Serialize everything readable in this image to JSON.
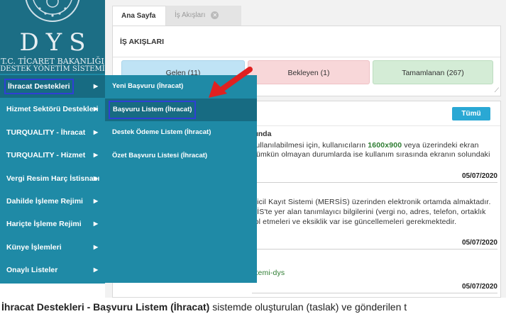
{
  "logo": {
    "title": "DYS",
    "line1": "T.C. TİCARET BAKANLIĞI",
    "line2": "DESTEK YÖNETİM SİSTEMİ"
  },
  "sidebar": {
    "items": [
      {
        "label": "İhracat Destekleri"
      },
      {
        "label": "Hizmet Sektörü Destekleri"
      },
      {
        "label": "TURQUALITY - İhracat"
      },
      {
        "label": "TURQUALITY - Hizmet"
      },
      {
        "label": "Vergi Resim Harç İstisnası"
      },
      {
        "label": "Dahilde İşleme Rejimi"
      },
      {
        "label": "Hariçte İşleme Rejimi"
      },
      {
        "label": "Künye İşlemleri"
      },
      {
        "label": "Onaylı Listeler"
      }
    ],
    "arrow_glyph": "▶"
  },
  "submenu": {
    "items": [
      {
        "label": "Yeni Başvuru (İhracat)"
      },
      {
        "label": "Başvuru Listem (İhracat)"
      },
      {
        "label": "Destek Ödeme Listem (İhracat)"
      },
      {
        "label": "Özet Başvuru Listesi (İhracat)"
      }
    ]
  },
  "tabs": {
    "home": "Ana Sayfa",
    "work": "İş Akışları",
    "close_glyph": "✕"
  },
  "workflow": {
    "title": "İŞ AKIŞLARI",
    "incoming": "Gelen (11)",
    "pending": "Bekleyen (1)",
    "completed": "Tamamlanan (267)"
  },
  "news": {
    "all_button": "Tümü",
    "item1": {
      "title": "kında",
      "line1_pre": "kullanılabilmesi için, kullanıcıların ",
      "line1_hl": "1600x900",
      "line1_post": " veya üzerindeki ekran",
      "line2": "nümkün olmayan durumlarda ise kullanım sırasında ekranın solundaki",
      "date": "05/07/2020"
    },
    "item2": {
      "line1": "Sicil Kayıt Sistemi (MERSİS) üzerinden elektronik ortamda almaktadır.",
      "line2": "SİS'te yer alan tanımlayıcı bilgilerini (vergi no, adres, telefon, ortaklık",
      "line3": "rol etmeleri ve eksiklik var ise güncellemeleri gerekmektedir.",
      "date": "05/07/2020"
    },
    "item3": {
      "line1": "stemi-dys",
      "date": "05/07/2020"
    }
  },
  "caption": {
    "bold": "İhracat Destekleri - Başvuru Listem (İhracat)",
    "rest": " sistemde oluşturulan (taslak) ve gönderilen t"
  },
  "colors": {
    "sidebar": "#1f8aa6",
    "sidebar_active": "#176b82",
    "highlight_outline": "#2f3fd6",
    "arrow": "#e02020",
    "accent_button": "#2aa8d4"
  },
  "icons": [
    "emblem-icon",
    "chevron-right-icon",
    "close-icon",
    "resize-handle-icon",
    "red-pointer-arrow-icon"
  ]
}
